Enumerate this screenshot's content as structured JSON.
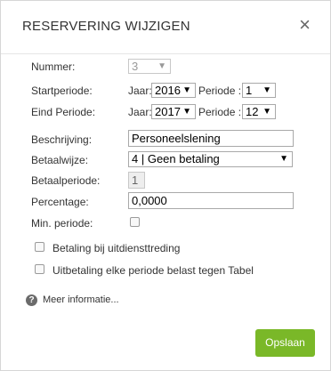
{
  "dialog": {
    "title": "RESERVERING WIJZIGEN",
    "close_glyph": "×"
  },
  "form": {
    "nummer": {
      "label": "Nummer:",
      "value": "3"
    },
    "startperiode": {
      "label": "Startperiode:",
      "jaar_label": "Jaar:",
      "jaar_value": "2016",
      "periode_label": "Periode :",
      "periode_value": "1"
    },
    "eindperiode": {
      "label": "Eind Periode:",
      "jaar_label": "Jaar:",
      "jaar_value": "2017",
      "periode_label": "Periode :",
      "periode_value": "12"
    },
    "beschrijving": {
      "label": "Beschrijving:",
      "value": "Personeelslening"
    },
    "betaalwijze": {
      "label": "Betaalwijze:",
      "value": "4 | Geen betaling"
    },
    "betaalperiode": {
      "label": "Betaalperiode:",
      "value": "1"
    },
    "percentage": {
      "label": "Percentage:",
      "value": "0,0000"
    },
    "min_periode": {
      "label": "Min. periode:",
      "checked": false
    },
    "checkbox_uitdienst": {
      "label": "Betaling bij uitdiensttreding",
      "checked": false
    },
    "checkbox_uitbetaling": {
      "label": "Uitbetaling elke periode belast tegen Tabel",
      "checked": false
    }
  },
  "help": {
    "icon_glyph": "?",
    "link_text": "Meer informatie..."
  },
  "actions": {
    "save_label": "Opslaan"
  },
  "colors": {
    "save_button": "#7ab828",
    "help_icon": "#6b6b6b"
  },
  "icons": {
    "dropdown_arrow": "▼",
    "help": "question-circle-icon",
    "close": "close-icon"
  }
}
